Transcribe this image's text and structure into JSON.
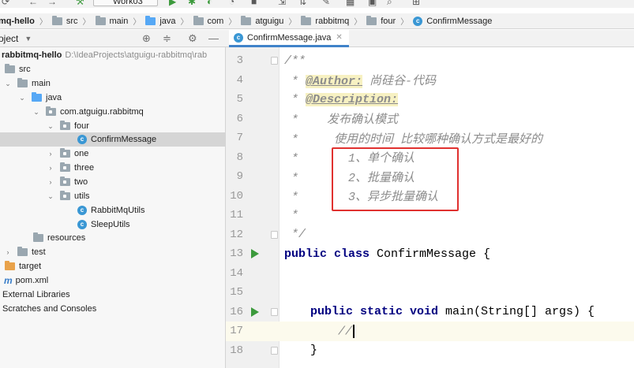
{
  "toolbar": {
    "run_config": "Work03",
    "icons": [
      "sync-icon",
      "back-icon",
      "forward-icon",
      "hammer-icon",
      "run-config-dropdown",
      "run-icon",
      "debug-icon",
      "coverage-icon",
      "profile-icon",
      "stop-icon",
      "attach-icon",
      "build-icon",
      "settings-icon",
      "layout-icon",
      "search-icon",
      "sdk-icon"
    ]
  },
  "breadcrumb": {
    "items": [
      {
        "label": "mq-hello",
        "icon": "project"
      },
      {
        "label": "src",
        "icon": "folder-icon"
      },
      {
        "label": "main",
        "icon": "folder-icon"
      },
      {
        "label": "java",
        "icon": "source-folder-icon"
      },
      {
        "label": "com",
        "icon": "folder-icon"
      },
      {
        "label": "atguigu",
        "icon": "folder-icon"
      },
      {
        "label": "rabbitmq",
        "icon": "folder-icon"
      },
      {
        "label": "four",
        "icon": "folder-icon"
      },
      {
        "label": "ConfirmMessage",
        "icon": "class-icon"
      }
    ]
  },
  "project_panel": {
    "title": "oject",
    "tree": [
      {
        "label": "rabbitmq-hello",
        "hint": "D:\\IdeaProjects\\atguigu-rabbitmq\\rab",
        "indent": 0
      },
      {
        "label": "src",
        "indent": 0
      },
      {
        "label": "main",
        "indent": 1
      },
      {
        "label": "java",
        "indent": 2
      },
      {
        "label": "com.atguigu.rabbitmq",
        "indent": 3
      },
      {
        "label": "four",
        "indent": 4
      },
      {
        "label": "ConfirmMessage",
        "indent": 5
      },
      {
        "label": "one",
        "indent": 4
      },
      {
        "label": "three",
        "indent": 4
      },
      {
        "label": "two",
        "indent": 4
      },
      {
        "label": "utils",
        "indent": 4
      },
      {
        "label": "RabbitMqUtils",
        "indent": 5
      },
      {
        "label": "SleepUtils",
        "indent": 5
      },
      {
        "label": "resources",
        "indent": 2
      },
      {
        "label": "test",
        "indent": 0
      },
      {
        "label": "target",
        "indent": 0
      },
      {
        "label": "pom.xml",
        "indent": 0
      },
      {
        "label": "External Libraries",
        "indent": 0
      },
      {
        "label": "Scratches and Consoles",
        "indent": 0
      }
    ]
  },
  "editor": {
    "tab_label": "ConfirmMessage.java",
    "lines": [
      {
        "n": "3",
        "text": "/**"
      },
      {
        "n": "4",
        "tag": "@Author:",
        "rest": " 尚硅谷-代码"
      },
      {
        "n": "5",
        "tag": "@Description:",
        "rest": ""
      },
      {
        "n": "6",
        "text": " *    发布确认模式"
      },
      {
        "n": "7",
        "text": " *     使用的时间 比较哪种确认方式是最好的"
      },
      {
        "n": "8",
        "text": " *       1、单个确认"
      },
      {
        "n": "9",
        "text": " *       2、批量确认"
      },
      {
        "n": "10",
        "text": " *       3、异步批量确认"
      },
      {
        "n": "11",
        "text": " *"
      },
      {
        "n": "12",
        "text": " */"
      },
      {
        "n": "13",
        "kw": "public class",
        "rest": " ConfirmMessage {"
      },
      {
        "n": "14",
        "text": ""
      },
      {
        "n": "15",
        "text": ""
      },
      {
        "n": "16",
        "kw": "public static void",
        "rest": " main(String[] args) {"
      },
      {
        "n": "17",
        "text": "//"
      },
      {
        "n": "18",
        "text": "}"
      }
    ]
  },
  "colors": {
    "highlight_box": "#e0312f",
    "run_gutter": "#3c9a3c"
  }
}
